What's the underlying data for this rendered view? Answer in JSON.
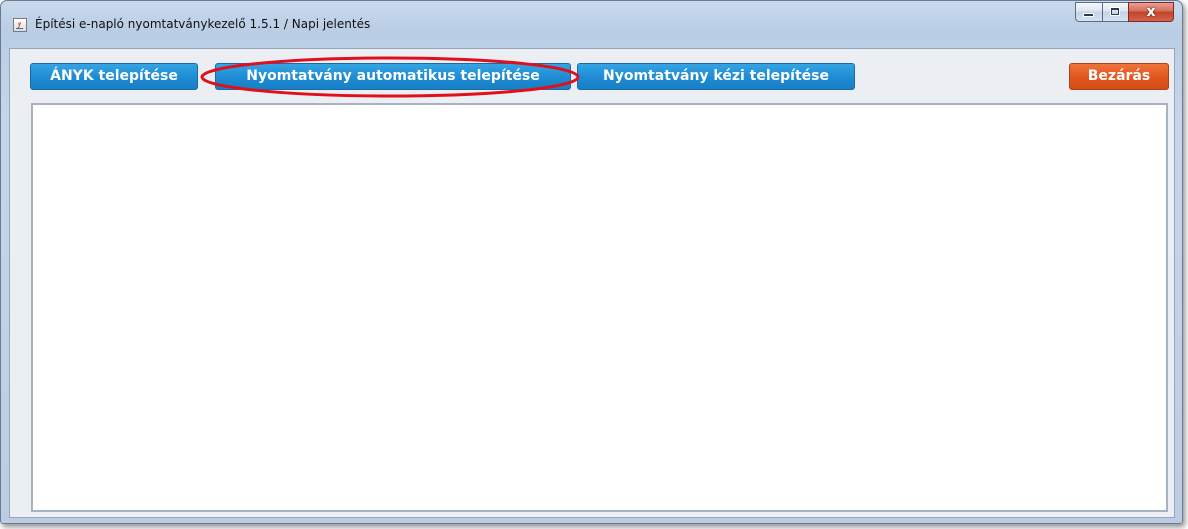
{
  "window": {
    "title": "Építési e-napló nyomtatványkezelő 1.5.1 / Napi jelentés",
    "icon": "java-app-icon",
    "controls": {
      "minimize_icon": "minimize-icon",
      "maximize_icon": "maximize-icon",
      "close_icon": "close-icon",
      "close_glyph": "x"
    }
  },
  "toolbar": {
    "anyk_install_label": "ÁNYK telepítése",
    "auto_install_label": "Nyomtatvány automatikus telepítése",
    "manual_install_label": "Nyomtatvány kézi telepítése",
    "close_label": "Bezárás"
  },
  "colors": {
    "button_blue": "#1e8bd2",
    "button_orange": "#e0561e",
    "highlight_ring": "#e0101a"
  }
}
